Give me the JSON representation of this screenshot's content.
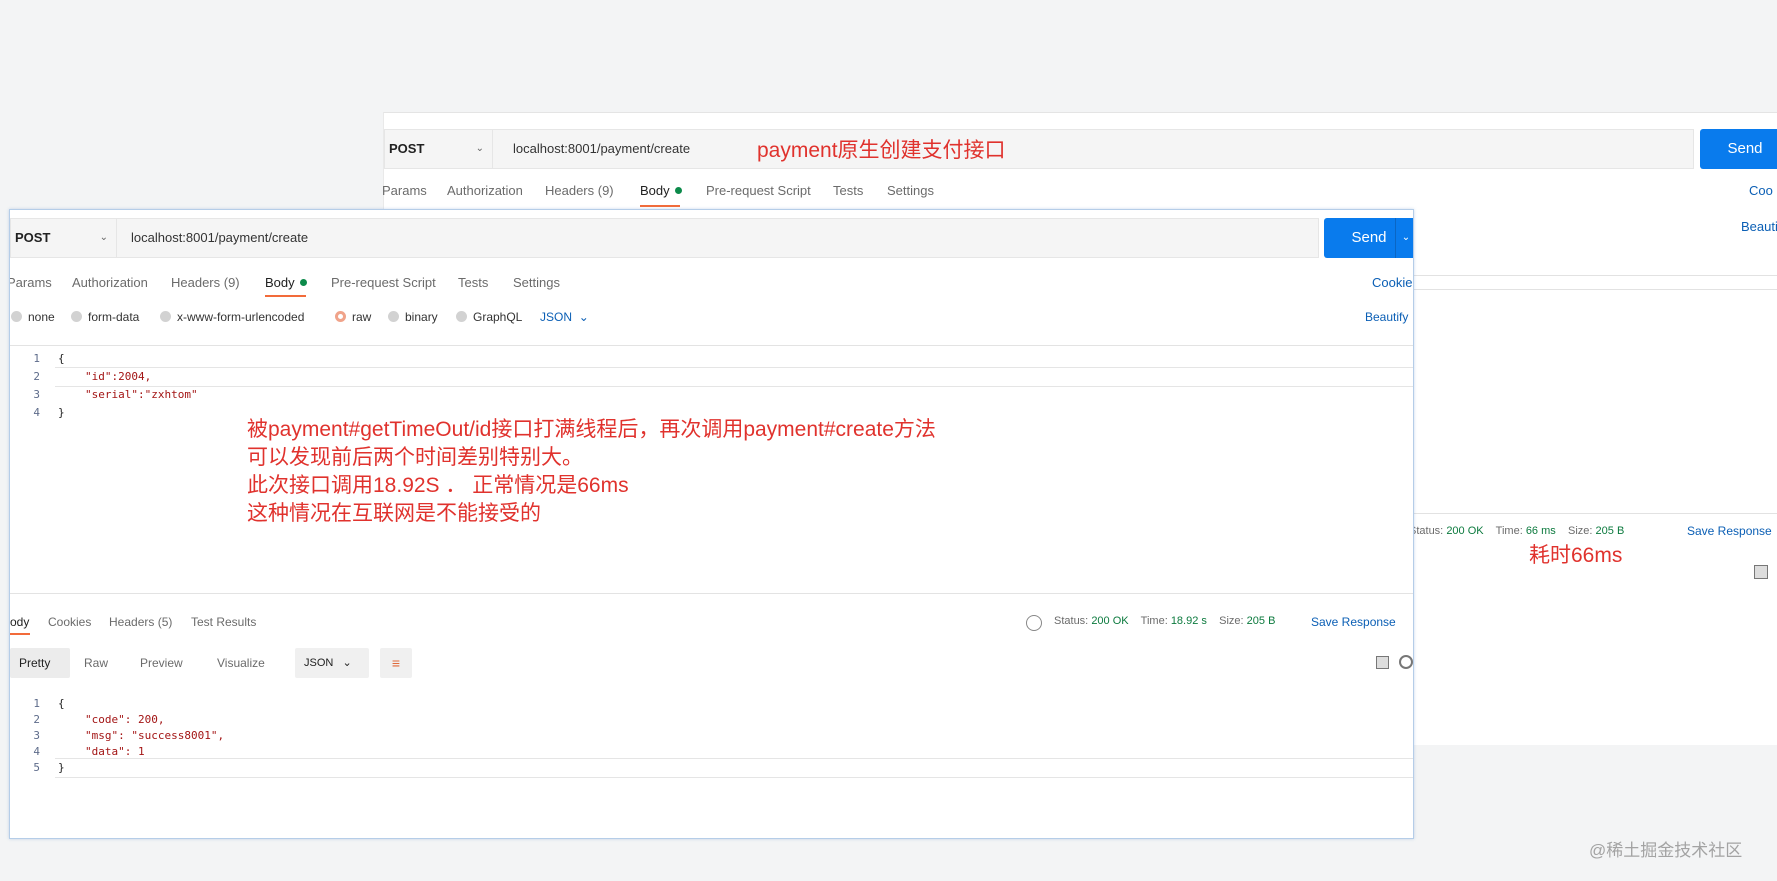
{
  "back": {
    "method": "POST",
    "url": "localhost:8001/payment/create",
    "annotation": "payment原生创建支付接口",
    "send": "Send",
    "tabs": [
      "Params",
      "Authorization",
      "Headers (9)",
      "Body",
      "Pre-request Script",
      "Tests",
      "Settings"
    ],
    "cookies": "Coo",
    "beautify": "Beauti",
    "status_label": "Status:",
    "status_value": "200 OK",
    "time_label": "Time:",
    "time_value": "66 ms",
    "size_label": "Size:",
    "size_value": "205 B",
    "save_response": "Save Response",
    "time_annotation": "耗时66ms"
  },
  "front": {
    "method": "POST",
    "url": "localhost:8001/payment/create",
    "send": "Send",
    "tabs": [
      "Params",
      "Authorization",
      "Headers (9)",
      "Body",
      "Pre-request Script",
      "Tests",
      "Settings"
    ],
    "cookies": "Cookie",
    "body_types": [
      "none",
      "form-data",
      "x-www-form-urlencoded",
      "raw",
      "binary",
      "GraphQL"
    ],
    "body_format": "JSON",
    "beautify": "Beautify",
    "request_lines": [
      "{",
      "\"id\":2004,",
      "\"serial\":\"zxhtom\"",
      "}"
    ],
    "annotation_lines": [
      "被payment#getTimeOut/id接口打满线程后，再次调用payment#create方法",
      "可以发现前后两个时间差别特别大。",
      "此次接口调用18.92S ． 正常情况是66ms",
      "这种情况在互联网是不能接受的"
    ],
    "response_tabs": [
      "Body",
      "Cookies",
      "Headers (5)",
      "Test Results"
    ],
    "status_label": "Status:",
    "status_value": "200 OK",
    "time_label": "Time:",
    "time_value": "18.92 s",
    "size_label": "Size:",
    "size_value": "205 B",
    "save_response": "Save Response",
    "view_tabs": [
      "Pretty",
      "Raw",
      "Preview",
      "Visualize"
    ],
    "response_format": "JSON",
    "response_lines": [
      "{",
      "\"code\": 200,",
      "\"msg\": \"success8001\",",
      "\"data\": 1",
      "}"
    ]
  },
  "watermark": "@稀土掘金技术社区"
}
